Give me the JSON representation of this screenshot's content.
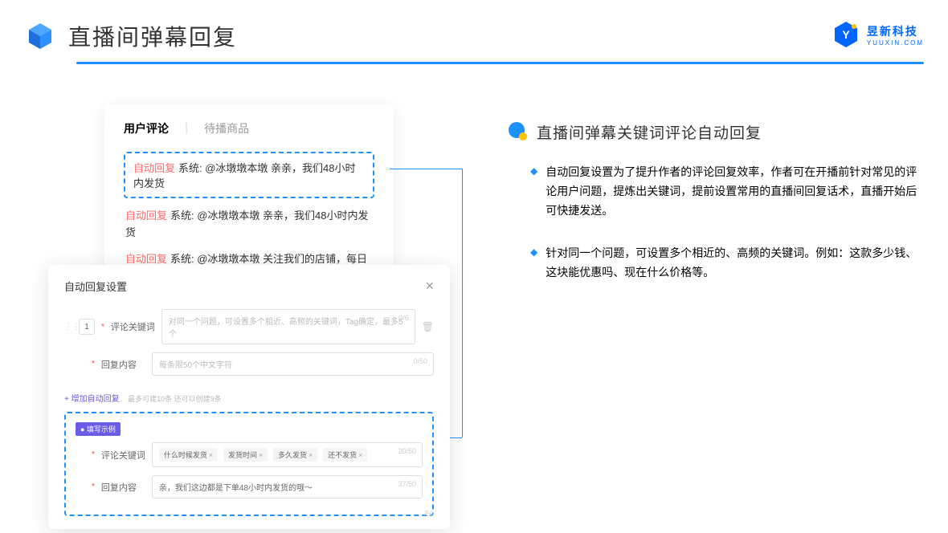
{
  "header": {
    "title": "直播间弹幕回复",
    "brand_name": "昱新科技",
    "brand_url": "YUUXIN.COM"
  },
  "comment_card": {
    "tab_active": "用户评论",
    "tab_inactive": "待播商品",
    "highlighted": {
      "tag": "自动回复",
      "text": "系统: @冰墩墩本墩 亲亲，我们48小时内发货"
    },
    "line2": {
      "tag": "自动回复",
      "text": "系统: @冰墩墩本墩 亲亲，我们48小时内发货"
    },
    "line3": {
      "tag": "自动回复",
      "text": "系统: @冰墩墩本墩 关注我们的店铺，每日都有热门推荐呦～"
    }
  },
  "modal": {
    "title": "自动回复设置",
    "row_num": "1",
    "keyword_label": "评论关键词",
    "keyword_placeholder": "对同一个问题，可设置多个相近、高频的关键词，Tag确定，最多5个",
    "keyword_counter": "0/6",
    "content_label": "回复内容",
    "content_placeholder": "每条限50个中文字符",
    "content_counter": "0/50",
    "add_link": "+ 增加自动回复",
    "add_hint": "最多可建10条 还可以创建9条",
    "example_badge": "● 填写示例",
    "ex_keyword_label": "评论关键词",
    "ex_tags": [
      "什么时候发货",
      "发货时间",
      "多久发货",
      "还不发货"
    ],
    "ex_keyword_counter": "20/50",
    "ex_content_label": "回复内容",
    "ex_content_value": "亲，我们这边都是下单48小时内发货的哦～",
    "ex_content_counter": "37/50",
    "bottom_counter": "/50"
  },
  "right": {
    "section_title": "直播间弹幕关键词评论自动回复",
    "bullet1": "自动回复设置为了提升作者的评论回复效率，作者可在开播前针对常见的评论用户问题，提炼出关键词，提前设置常用的直播间回复话术，直播开始后可快捷发送。",
    "bullet2": "针对同一个问题，可设置多个相近的、高频的关键词。例如：这款多少钱、这块能优惠吗、现在什么价格等。"
  }
}
